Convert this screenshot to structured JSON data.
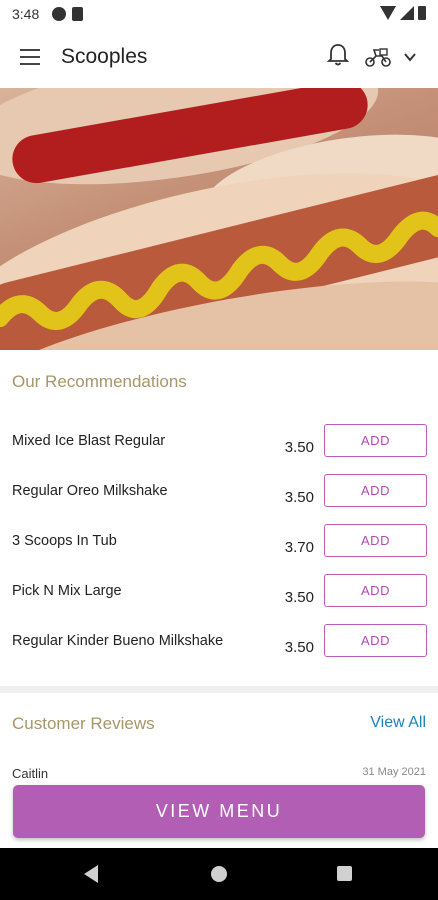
{
  "status": {
    "time": "3:48"
  },
  "appbar": {
    "title": "Scooples"
  },
  "recommendations": {
    "title": "Our Recommendations",
    "add_label": "ADD",
    "items": [
      {
        "name": "Mixed Ice Blast Regular",
        "price": "3.50"
      },
      {
        "name": "Regular Oreo Milkshake",
        "price": "3.50"
      },
      {
        "name": "3 Scoops In Tub",
        "price": "3.70"
      },
      {
        "name": "Pick N Mix Large",
        "price": "3.50"
      },
      {
        "name": "Regular Kinder Bueno Milkshake",
        "price": "3.50"
      }
    ]
  },
  "reviews": {
    "title": "Customer Reviews",
    "view_all": "View All",
    "first_reviewer": "Caitlin",
    "first_date": "31 May 2021"
  },
  "cta": {
    "view_menu": "VIEW MENU"
  },
  "colors": {
    "accent": "#b35eb5",
    "section_title": "#a8956a",
    "link": "#1e84b8"
  },
  "icons": [
    "menu-icon",
    "bell-icon",
    "scooter-icon",
    "chevron-down-icon"
  ]
}
